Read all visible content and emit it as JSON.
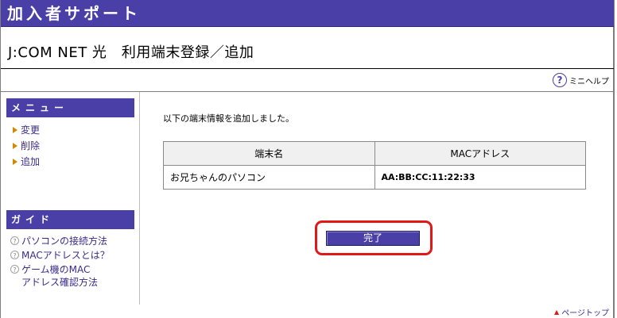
{
  "header": {
    "title": "加入者サポート"
  },
  "page": {
    "title": "J:COM NET 光　利用端末登録／追加"
  },
  "help": {
    "icon": "question-icon",
    "label": "ミニヘルプ"
  },
  "menu": {
    "heading": "メニュー",
    "items": [
      {
        "label": "変更"
      },
      {
        "label": "削除"
      },
      {
        "label": "追加"
      }
    ]
  },
  "guide": {
    "heading": "ガイド",
    "items": [
      {
        "label": "パソコンの接続方法"
      },
      {
        "label": "MACアドレスとは？"
      },
      {
        "label": "ゲーム機のMAC\nアドレス確認方法"
      }
    ]
  },
  "main": {
    "message": "以下の端末情報を追加しました。",
    "table": {
      "headers": [
        "端末名",
        "MACアドレス"
      ],
      "rows": [
        {
          "name": "お兄ちゃんのパソコン",
          "mac": "AA:BB:CC:11:22:33"
        }
      ]
    },
    "done_button": "完了"
  },
  "footer": {
    "pagetop": "ページトップ"
  },
  "colors": {
    "accent": "#4a3fa6",
    "highlight": "#e01818",
    "link": "#3a2a8a"
  }
}
